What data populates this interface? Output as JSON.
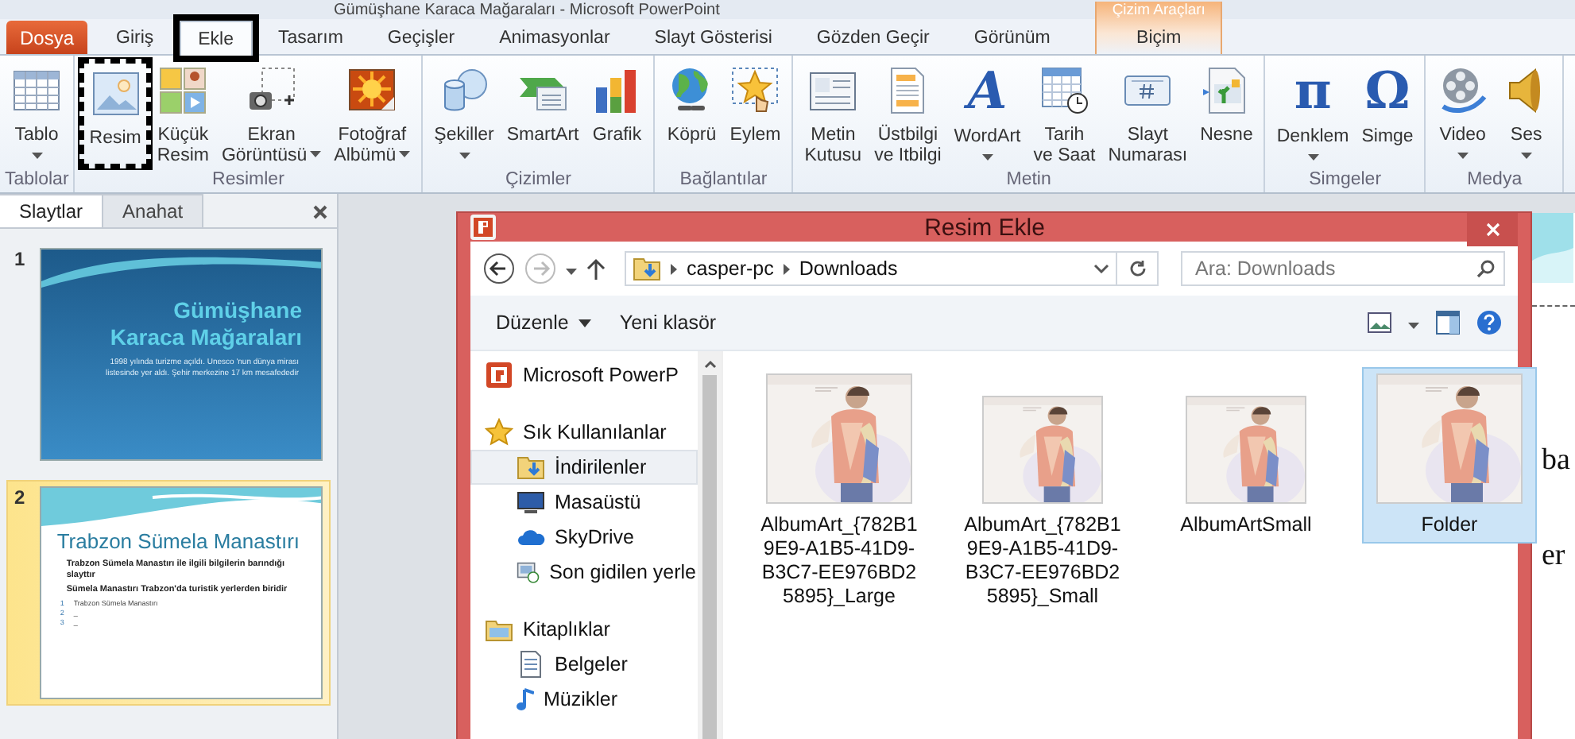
{
  "window": {
    "title": "Gümüşhane Karaca Mağaraları - Microsoft PowerPoint",
    "contextual_group": "Çizim Araçları"
  },
  "file_tab": "Dosya",
  "tabs": [
    {
      "label": "Giriş",
      "selected": false,
      "annotated": false,
      "contextual": false
    },
    {
      "label": "Ekle",
      "selected": true,
      "annotated": true,
      "contextual": false
    },
    {
      "label": "Tasarım",
      "selected": false,
      "annotated": false,
      "contextual": false
    },
    {
      "label": "Geçişler",
      "selected": false,
      "annotated": false,
      "contextual": false
    },
    {
      "label": "Animasyonlar",
      "selected": false,
      "annotated": false,
      "contextual": false
    },
    {
      "label": "Slayt Gösterisi",
      "selected": false,
      "annotated": false,
      "contextual": false
    },
    {
      "label": "Gözden Geçir",
      "selected": false,
      "annotated": false,
      "contextual": false
    },
    {
      "label": "Görünüm",
      "selected": false,
      "annotated": false,
      "contextual": false
    },
    {
      "label": "Biçim",
      "selected": false,
      "annotated": false,
      "contextual": true
    }
  ],
  "ribbon": [
    {
      "label": "Tablolar",
      "buttons": [
        {
          "lines": [
            "Tablo"
          ],
          "dropdown": true,
          "annotated": false
        }
      ]
    },
    {
      "label": "Resimler",
      "buttons": [
        {
          "lines": [
            "Resim"
          ],
          "dropdown": false,
          "annotated": true
        },
        {
          "lines": [
            "Küçük",
            "Resim"
          ],
          "dropdown": false,
          "annotated": false
        },
        {
          "lines": [
            "Ekran",
            "Görüntüsü"
          ],
          "dropdown": true,
          "annotated": false
        },
        {
          "lines": [
            "Fotoğraf",
            "Albümü"
          ],
          "dropdown": true,
          "annotated": false
        }
      ]
    },
    {
      "label": "Çizimler",
      "buttons": [
        {
          "lines": [
            "Şekiller"
          ],
          "dropdown": true,
          "annotated": false
        },
        {
          "lines": [
            "SmartArt"
          ],
          "dropdown": false,
          "annotated": false
        },
        {
          "lines": [
            "Grafik"
          ],
          "dropdown": false,
          "annotated": false
        }
      ]
    },
    {
      "label": "Bağlantılar",
      "buttons": [
        {
          "lines": [
            "Köprü"
          ],
          "dropdown": false,
          "annotated": false
        },
        {
          "lines": [
            "Eylem"
          ],
          "dropdown": false,
          "annotated": false
        }
      ]
    },
    {
      "label": "Metin",
      "buttons": [
        {
          "lines": [
            "Metin",
            "Kutusu"
          ],
          "dropdown": false,
          "annotated": false
        },
        {
          "lines": [
            "Üstbilgi",
            "ve Itbilgi"
          ],
          "dropdown": false,
          "annotated": false
        },
        {
          "lines": [
            "WordArt"
          ],
          "dropdown": true,
          "annotated": false,
          "glyph": "A"
        },
        {
          "lines": [
            "Tarih",
            "ve Saat"
          ],
          "dropdown": false,
          "annotated": false
        },
        {
          "lines": [
            "Slayt",
            "Numarası"
          ],
          "dropdown": false,
          "annotated": false
        },
        {
          "lines": [
            "Nesne"
          ],
          "dropdown": false,
          "annotated": false
        }
      ]
    },
    {
      "label": "Simgeler",
      "buttons": [
        {
          "lines": [
            "Denklem"
          ],
          "dropdown": true,
          "annotated": false,
          "glyph": "π"
        },
        {
          "lines": [
            "Simge"
          ],
          "dropdown": false,
          "annotated": false,
          "glyph": "Ω"
        }
      ]
    },
    {
      "label": "Medya",
      "buttons": [
        {
          "lines": [
            "Video"
          ],
          "dropdown": true,
          "annotated": false
        },
        {
          "lines": [
            "Ses"
          ],
          "dropdown": true,
          "annotated": false
        }
      ]
    }
  ],
  "slides_panel": {
    "tabs": [
      {
        "label": "Slaytlar",
        "selected": true
      },
      {
        "label": "Anahat",
        "selected": false
      }
    ],
    "slides": [
      {
        "number": "1",
        "selected": false,
        "kind": "title",
        "title": "Gümüşhane Karaca Mağaraları",
        "body": "1998 yılında turizme açıldı. Unesco 'nun dünya mirası listesinde yer aldı. Şehir merkezine 17 km mesafededir"
      },
      {
        "number": "2",
        "selected": true,
        "kind": "content",
        "title": "Trabzon Sümela Manastırı",
        "bullets": [
          "Trabzon Sümela Manastırı ile ilgili bilgilerin barındığı slayttır",
          "Sümela Manastırı Trabzon'da turistik yerlerden biridir"
        ],
        "numbered": [
          {
            "number": "1",
            "text": "Trabzon Sümela Manastırı"
          },
          {
            "number": "2",
            "text": "_"
          },
          {
            "number": "3",
            "text": "_"
          }
        ]
      }
    ]
  },
  "slide_edge": {
    "lines": [
      "ba",
      "er"
    ]
  },
  "dialog": {
    "title": "Resim Ekle",
    "path": [
      "casper-pc",
      "Downloads"
    ],
    "search": {
      "placeholder": "Ara: Downloads"
    },
    "toolbar": {
      "organize": "Düzenle",
      "new_folder": "Yeni klasör"
    },
    "nav": [
      {
        "label": "Microsoft PowerP",
        "kind": "powerpoint"
      },
      {
        "label": "Sık Kullanılanlar",
        "kind": "star",
        "children": [
          {
            "label": "İndirilenler",
            "kind": "downloads",
            "selected": true
          },
          {
            "label": "Masaüstü",
            "kind": "desktop",
            "selected": false
          },
          {
            "label": "SkyDrive",
            "kind": "cloud",
            "selected": false
          },
          {
            "label": "Son gidilen yerle",
            "kind": "recent",
            "selected": false
          }
        ]
      },
      {
        "label": "Kitaplıklar",
        "kind": "library",
        "children": [
          {
            "label": "Belgeler",
            "kind": "document",
            "selected": false
          },
          {
            "label": "Müzikler",
            "kind": "music",
            "selected": false
          }
        ]
      }
    ],
    "files": [
      {
        "name": "AlbumArt_{782B19E9-A1B5-41D9-B3C7-EE976BD25895}_Large",
        "selected": false,
        "kind": "large"
      },
      {
        "name": "AlbumArt_{782B19E9-A1B5-41D9-B3C7-EE976BD25895}_Small",
        "selected": false,
        "kind": "small"
      },
      {
        "name": "AlbumArtSmall",
        "selected": false,
        "kind": "small"
      },
      {
        "name": "Folder",
        "selected": true,
        "kind": "large"
      }
    ]
  }
}
